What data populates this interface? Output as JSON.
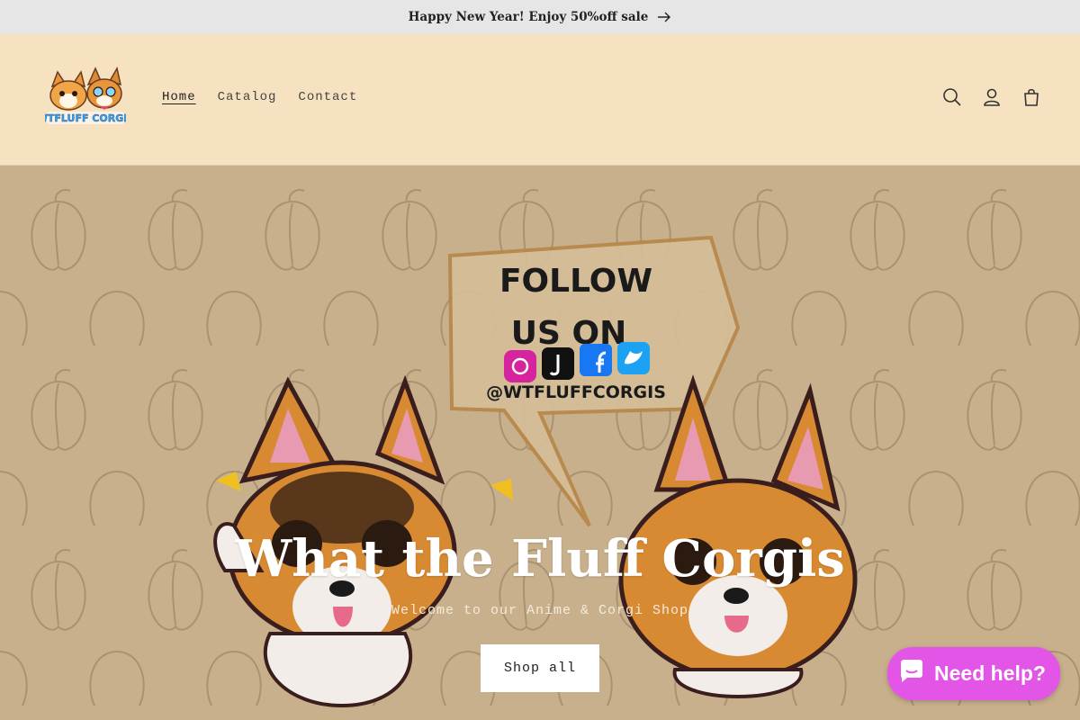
{
  "announcement": {
    "text": "Happy New Year! Enjoy 50%off sale",
    "icon": "arrow-right-icon"
  },
  "header": {
    "logo_text": "WTFLUFF CORGIS",
    "nav": [
      {
        "label": "Home",
        "active": true
      },
      {
        "label": "Catalog",
        "active": false
      },
      {
        "label": "Contact",
        "active": false
      }
    ],
    "icons": [
      "search-icon",
      "account-icon",
      "cart-icon"
    ]
  },
  "hero": {
    "title": "What the Fluff Corgis",
    "subtitle": "Welcome to our Anime & Corgi Shop",
    "cta_label": "Shop all",
    "bubble": {
      "line1": "FOLLOW",
      "line2": "US ON",
      "handle": "@WTFLUFFCORGIS"
    }
  },
  "chat": {
    "label": "Need help?",
    "icon": "chat-icon"
  },
  "colors": {
    "header_bg": "#f6e2c0",
    "hero_bg": "#c8b08c",
    "chat_bg": "#e255e6",
    "announce_bg": "#e6e6e6"
  }
}
